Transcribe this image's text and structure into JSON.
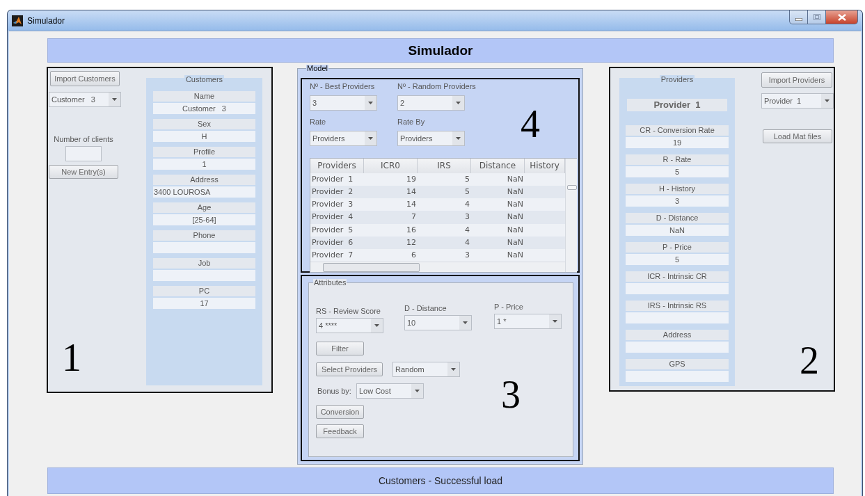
{
  "window": {
    "title": "Simulador"
  },
  "header": {
    "title": "Simulador"
  },
  "customers_panel": {
    "import_button": "Import Customers",
    "customer_select": "Customer   3",
    "clients_label": "Number of clients",
    "new_entry_button": "New Entry(s)",
    "annotation": "1",
    "details": {
      "title": "Customers",
      "fields": [
        {
          "label": "Name",
          "value": "Customer   3",
          "kind": "centered"
        },
        {
          "label": "Sex",
          "value": "H",
          "kind": "centered"
        },
        {
          "label": "Profile",
          "value": "1",
          "kind": "centered"
        },
        {
          "label": "Address",
          "value": "3400 LOUROSA",
          "kind": "plain"
        },
        {
          "label": "Age",
          "value": "[25-64]",
          "kind": "centered"
        },
        {
          "label": "Phone",
          "kind": "centered"
        },
        {
          "label": "Job",
          "kind": "centered"
        },
        {
          "label": "PC",
          "value": "17",
          "kind": "centered"
        }
      ]
    }
  },
  "model_panel": {
    "title": "Model",
    "annotation": "4",
    "selectors": [
      {
        "label": "Nº - Best Providers",
        "value": "3"
      },
      {
        "label": "Nº - Random Providers",
        "value": "2"
      },
      {
        "label": "Rate",
        "value": "Providers"
      },
      {
        "label": "Rate By",
        "value": "Providers"
      }
    ],
    "table": {
      "columns": [
        "Providers",
        "ICR0",
        "IRS",
        "Distance",
        "History"
      ],
      "rows": [
        [
          "Provider  1",
          "19",
          "5",
          "NaN"
        ],
        [
          "Provider  2",
          "14",
          "5",
          "NaN"
        ],
        [
          "Provider  3",
          "14",
          "4",
          "NaN"
        ],
        [
          "Provider  4",
          "7",
          "3",
          "NaN"
        ],
        [
          "Provider  5",
          "16",
          "4",
          "NaN"
        ],
        [
          "Provider  6",
          "12",
          "4",
          "NaN"
        ],
        [
          "Provider  7",
          "6",
          "3",
          "NaN"
        ]
      ]
    }
  },
  "attributes_panel": {
    "title": "Attributes",
    "annotation": "3",
    "selectors": [
      {
        "label": "RS - Review Score",
        "value": "4 ****"
      },
      {
        "label": "D - Distance",
        "value": "10"
      },
      {
        "label": "P - Price",
        "value": "1 *"
      }
    ],
    "filter_button": "Filter",
    "select_button": "Select Providers",
    "select_mode": "Random",
    "bonus_label": "Bonus by:",
    "bonus_value": "Low Cost",
    "conversion_button": "Conversion",
    "feedback_button": "Feedback"
  },
  "providers_panel": {
    "title": "Providers",
    "provider_name": "Provider  1",
    "import_button": "Import Providers",
    "provider_select": "Provider  1",
    "load_button": "Load Mat files",
    "annotation": "2",
    "fields": [
      {
        "label": "CR - Conversion Rate",
        "value": "19"
      },
      {
        "label": "R - Rate",
        "value": "5"
      },
      {
        "label": "H - History",
        "value": "3"
      },
      {
        "label": "D - Distance",
        "value": "NaN"
      },
      {
        "label": "P - Price",
        "value": "5"
      },
      {
        "label": "ICR - Intrinsic CR"
      },
      {
        "label": "IRS  - Intrinsic RS"
      },
      {
        "label": "Address"
      },
      {
        "label": "GPS"
      }
    ]
  },
  "status_bar": {
    "text": "Customers - Successful load"
  }
}
